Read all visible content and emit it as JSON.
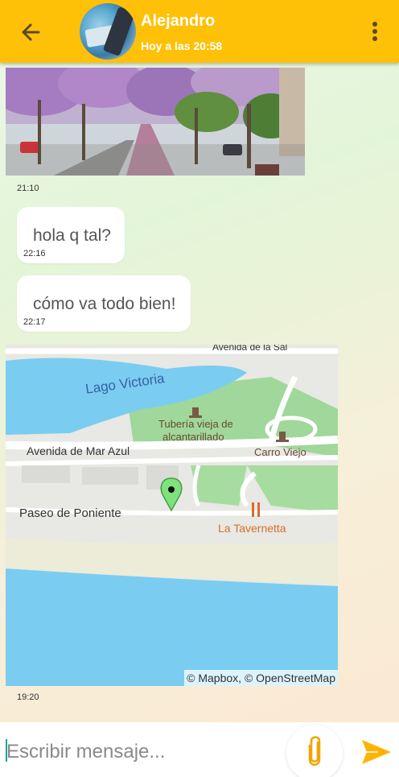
{
  "header": {
    "contact_name": "Alejandro",
    "status": "Hoy a las 20:58",
    "back_icon": "arrow-left-icon",
    "menu_icon": "more-vertical-icon",
    "accent_color": "#ffc107"
  },
  "messages": [
    {
      "type": "image",
      "time": "21:10"
    },
    {
      "type": "text",
      "text": "hola q tal?",
      "time": "22:16"
    },
    {
      "type": "text",
      "text": "cómo va todo bien!",
      "time": "22:17"
    },
    {
      "type": "location",
      "time": "19:20"
    }
  ],
  "map": {
    "labels": {
      "top_street": "Avenida de la Sal",
      "lake": "Lago Victoria",
      "poi_pipe_1": "Tubería vieja de",
      "poi_pipe_2": "alcantarillado",
      "street_mar_azul": "Avenida de Mar Azul",
      "poi_carro": "Carro Viejo",
      "street_poniente": "Paseo de Poniente",
      "restaurant": "La Tavernetta"
    },
    "attribution": "© Mapbox, © OpenStreetMap",
    "pin_color": "#7ee37a",
    "water_color": "#7acdf0"
  },
  "composer": {
    "placeholder": "Escribir mensaje...",
    "value": "",
    "attach_icon": "paperclip-icon",
    "send_icon": "send-icon"
  }
}
